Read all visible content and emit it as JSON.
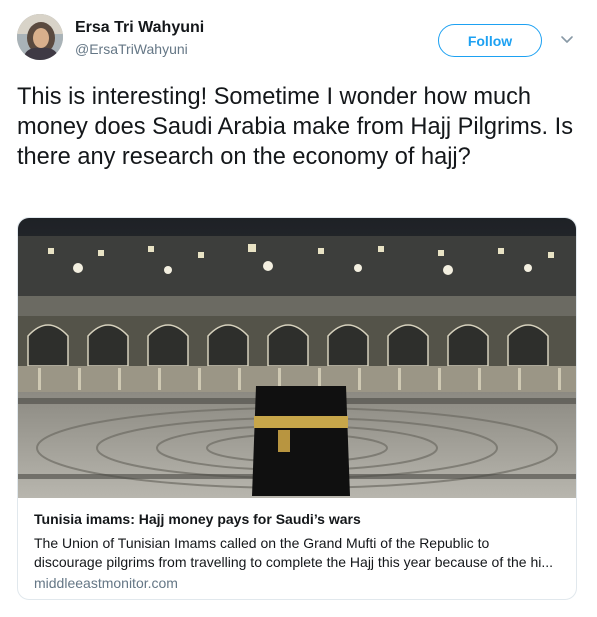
{
  "author": {
    "name": "Ersa Tri Wahyuni",
    "handle": "@ErsaTriWahyuni"
  },
  "follow_label": "Follow",
  "tweet_text": "This is interesting! Sometime I wonder how much money does Saudi Arabia make from Hajj Pilgrims. Is there any research on the economy of hajj?",
  "card": {
    "title": "Tunisia imams: Hajj money pays for Saudi’s wars",
    "description_line1": "The Union of Tunisian Imams called on the Grand Mufti of the Republic to",
    "description_line2": "discourage pilgrims from travelling to complete the Hajj this year because of the hi...",
    "domain": "middleeastmonitor.com"
  },
  "icons": {
    "chevron": "chevron-down-icon",
    "avatar": "avatar"
  },
  "colors": {
    "accent": "#1da1f2",
    "secondary_text": "#657786",
    "border": "#e1e8ed"
  }
}
